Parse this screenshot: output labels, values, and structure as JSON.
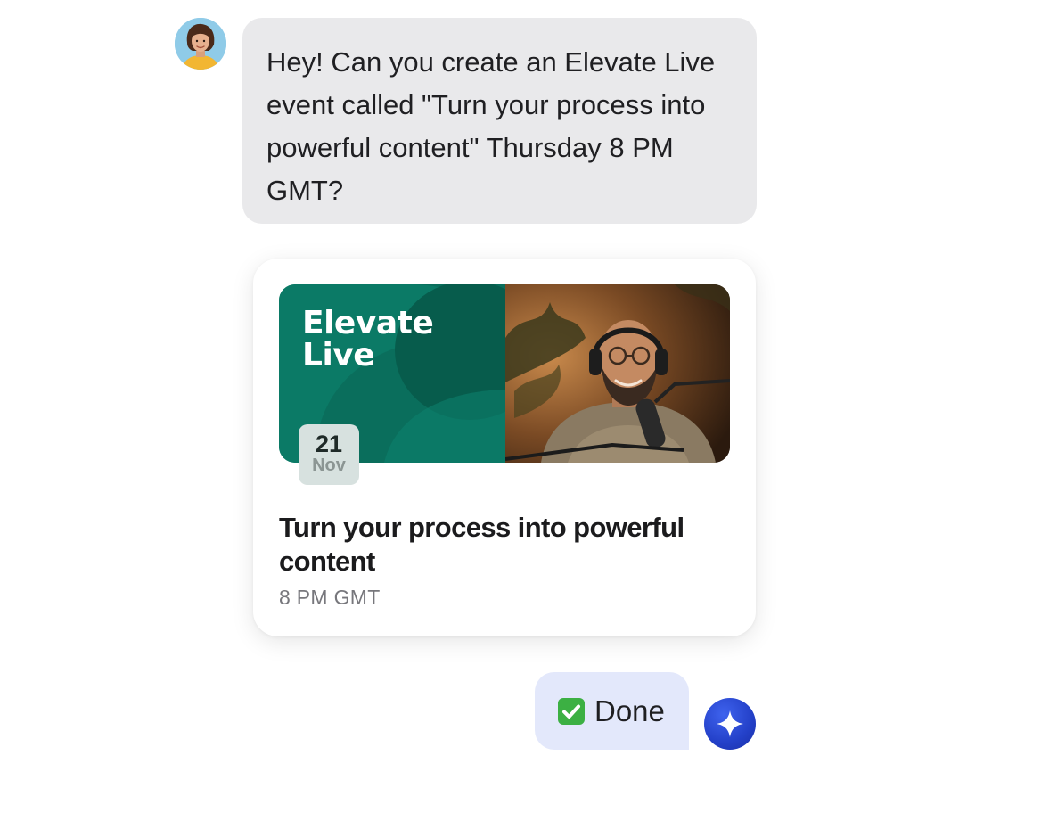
{
  "conversation": {
    "user_message": {
      "text": "Hey! Can you create an Elevate Live event called \"Turn your process into powerful content\" Thursday 8 PM GMT?",
      "avatar_icon": "user-avatar-woman-portrait",
      "bubble_color": "#e9e9eb"
    },
    "event_card": {
      "brand_title": "Elevate Live",
      "brand_color": "#0b7a66",
      "photo": "man-with-headphones-podcast-microphone",
      "date_day": "21",
      "date_month": "Nov",
      "title": "Turn your process into powerful content",
      "time": "8 PM GMT"
    },
    "assistant_message": {
      "icon": "check-mark-button-icon",
      "text": "Done",
      "bubble_color": "#e3e8fb",
      "avatar_icon": "sparkle-icon",
      "avatar_color": "#2a46d0"
    }
  }
}
